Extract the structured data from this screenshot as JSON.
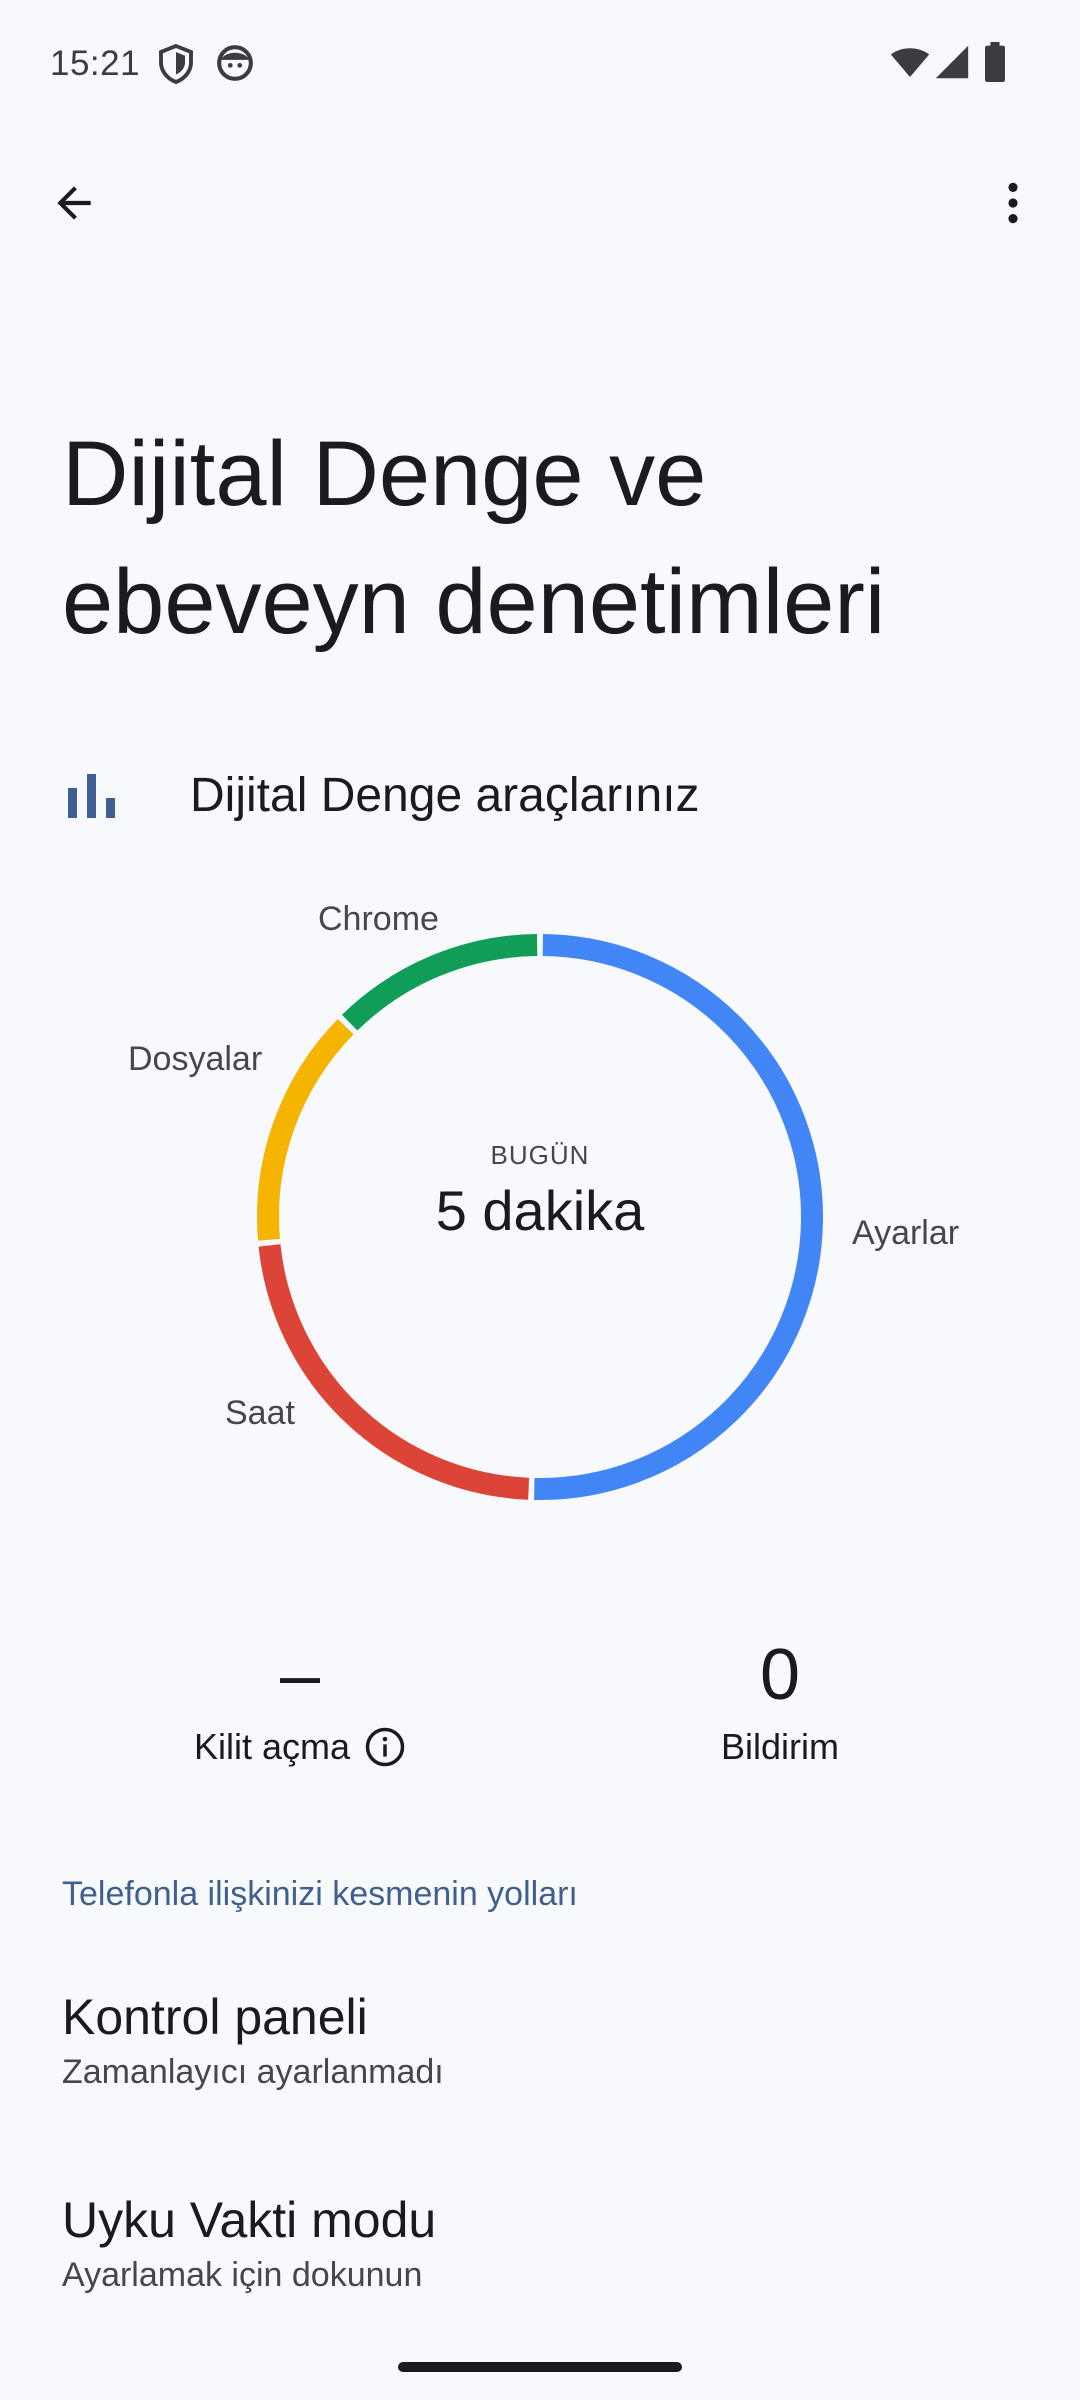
{
  "status_bar": {
    "time": "15:21",
    "left_icons": [
      "shield-icon",
      "face-icon"
    ],
    "right_icons": [
      "wifi-icon",
      "cell-signal-icon",
      "battery-icon"
    ]
  },
  "app_bar": {
    "back_icon": "arrow-back-icon",
    "more_icon": "more-vert-icon"
  },
  "page": {
    "title_line1": "Dijital Denge ve",
    "title_line2": "ebeveyn denetimleri"
  },
  "tools_header": {
    "icon": "bar-chart-icon",
    "label": "Dijital Denge araçlarınız"
  },
  "chart_data": {
    "type": "pie",
    "style": "donut",
    "center_caption": "BUGÜN",
    "center_value": "5 dakika",
    "slices": [
      {
        "label": "Ayarlar",
        "fraction": 0.505,
        "color": "#4285f4"
      },
      {
        "label": "Saat",
        "fraction": 0.23,
        "color": "#db4437"
      },
      {
        "label": "Dosyalar",
        "fraction": 0.14,
        "color": "#f4b400"
      },
      {
        "label": "Chrome",
        "fraction": 0.125,
        "color": "#0f9d58"
      }
    ]
  },
  "stats": {
    "unlocks": {
      "value": "–",
      "label": "Kilit açma",
      "icon": "info-icon"
    },
    "notifications": {
      "value": "0",
      "label": "Bildirim"
    }
  },
  "section_link": "Telefonla ilişkinizi kesmenin yolları",
  "items": [
    {
      "title": "Kontrol paneli",
      "subtitle": "Zamanlayıcı ayarlanmadı"
    },
    {
      "title": "Uyku Vakti modu",
      "subtitle": "Ayarlamak için dokunun"
    }
  ]
}
